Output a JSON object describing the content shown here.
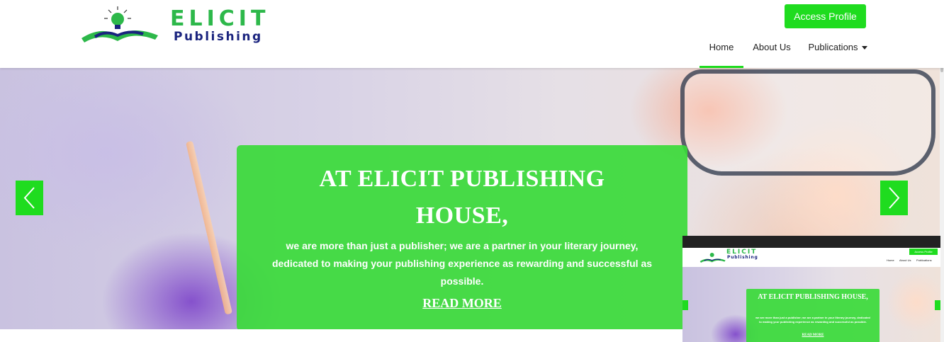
{
  "header": {
    "logo": {
      "title": "ELICIT",
      "subtitle": "Publishing"
    },
    "access_button": "Access Profile",
    "nav": [
      {
        "label": "Home",
        "active": true
      },
      {
        "label": "About Us",
        "active": false
      },
      {
        "label": "Publications",
        "active": false,
        "dropdown": true
      }
    ]
  },
  "hero": {
    "title": "AT ELICIT PUBLISHING HOUSE,",
    "text": "we are more than just a publisher; we are a partner in your literary journey, dedicated to making your publishing experience as rewarding and successful as possible.",
    "link": "READ MORE",
    "prev_icon": "chevron-left-icon",
    "next_icon": "chevron-right-icon"
  },
  "preview": {
    "logo_title": "ELICIT",
    "logo_subtitle": "Publishing",
    "access_button": "Access Profile",
    "nav": [
      "Home",
      "About Us",
      "Publications"
    ],
    "title": "AT ELICIT PUBLISHING HOUSE,",
    "text": "we are more than just a publisher; we are a partner in your literary journey, dedicated to making your publishing experience as rewarding and successful as possible.",
    "link": "READ MORE"
  },
  "colors": {
    "accent": "#1fdc1f",
    "brand_green": "#2db84a",
    "brand_navy": "#1a237e",
    "slide_box": "#3ada3a"
  }
}
